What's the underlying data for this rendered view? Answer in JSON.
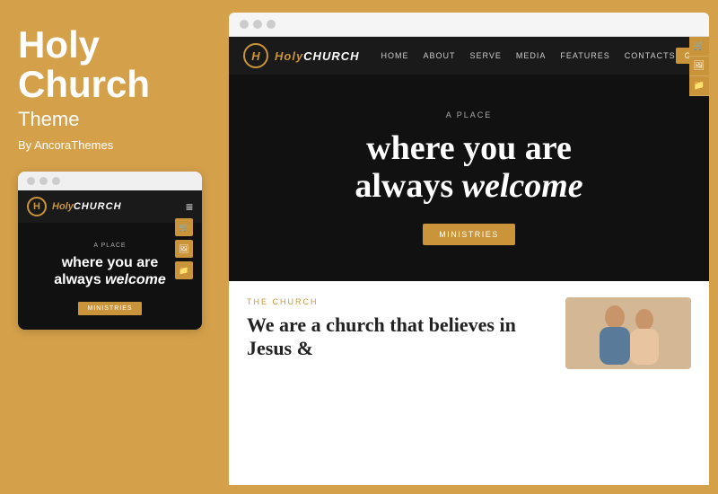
{
  "left": {
    "title_line1": "Holy",
    "title_line2": "Church",
    "subtitle": "Theme",
    "by": "By AncoraThemes"
  },
  "mini_browser": {
    "dots": [
      "●",
      "●",
      "●"
    ],
    "logo_letter": "H",
    "logo_text_italic": "Holy",
    "logo_text_normal": "CHURCH",
    "hamburger": "≡",
    "a_place": "A PLACE",
    "hero_line1": "where you are",
    "hero_line2": "always",
    "hero_line2_italic": "welcome",
    "cta": "MINISTRIES"
  },
  "main_browser": {
    "dots": [
      "●",
      "●",
      "●"
    ],
    "nav": {
      "logo_letter": "H",
      "logo_italic": "Holy",
      "logo_normal": "CHURCH",
      "links": [
        "HOME",
        "ABOUT",
        "SERVE",
        "MEDIA",
        "FEATURES",
        "CONTACTS"
      ],
      "give": "GIVE"
    },
    "hero": {
      "a_place": "A PLACE",
      "line1": "where you are",
      "line2": "always",
      "line2_italic": "welcome",
      "cta": "MINISTRIES"
    },
    "below": {
      "tag": "THE CHURCH",
      "title": "We are a church that believes in Jesus &"
    },
    "icons": [
      "🛒",
      "🖼",
      "📁"
    ]
  },
  "accent_color": "#c9943a",
  "bg_color": "#d4a04a"
}
